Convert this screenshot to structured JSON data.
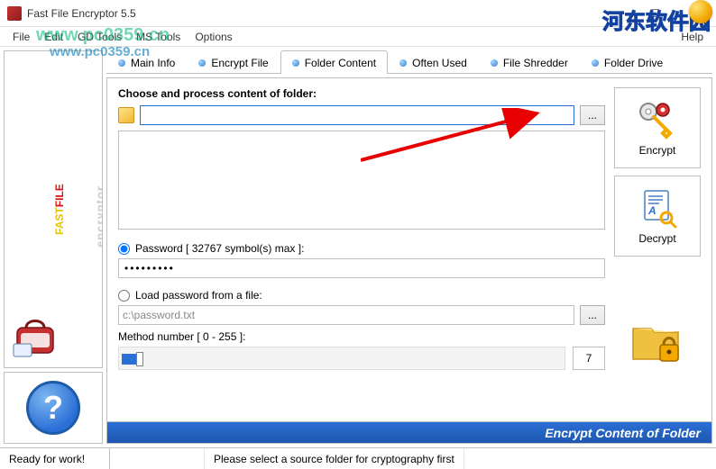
{
  "window": {
    "title": "Fast File Encryptor 5.5"
  },
  "menu": {
    "file": "File",
    "edit": "Edit",
    "gd": "GD Tools",
    "ms": "MS Tools",
    "options": "Options",
    "help": "Help"
  },
  "watermark": {
    "line1": "www.pc0359.cn",
    "line2": "www.pc0359.cn",
    "cn": "河东软件园"
  },
  "tabs": {
    "main_info": "Main Info",
    "encrypt_file": "Encrypt File",
    "folder_content": "Folder Content",
    "often_used": "Often Used",
    "file_shredder": "File Shredder",
    "folder_drive": "Folder Drive"
  },
  "panel": {
    "heading": "Choose and process content of folder:",
    "folder_path": "",
    "browse": "...",
    "pwd_radio": "Password [ 32767 symbol(s) max ]:",
    "pwd_value": "•••••••••",
    "file_radio": "Load password from a file:",
    "file_path": "c:\\password.txt",
    "method_label": "Method number [ 0 - 255 ]:",
    "method_value": "7"
  },
  "actions": {
    "encrypt": "Encrypt",
    "decrypt": "Decrypt"
  },
  "bluebar": "Encrypt Content of Folder",
  "status": {
    "ready": "Ready for work!",
    "hint": "Please select a source folder for cryptography first"
  }
}
